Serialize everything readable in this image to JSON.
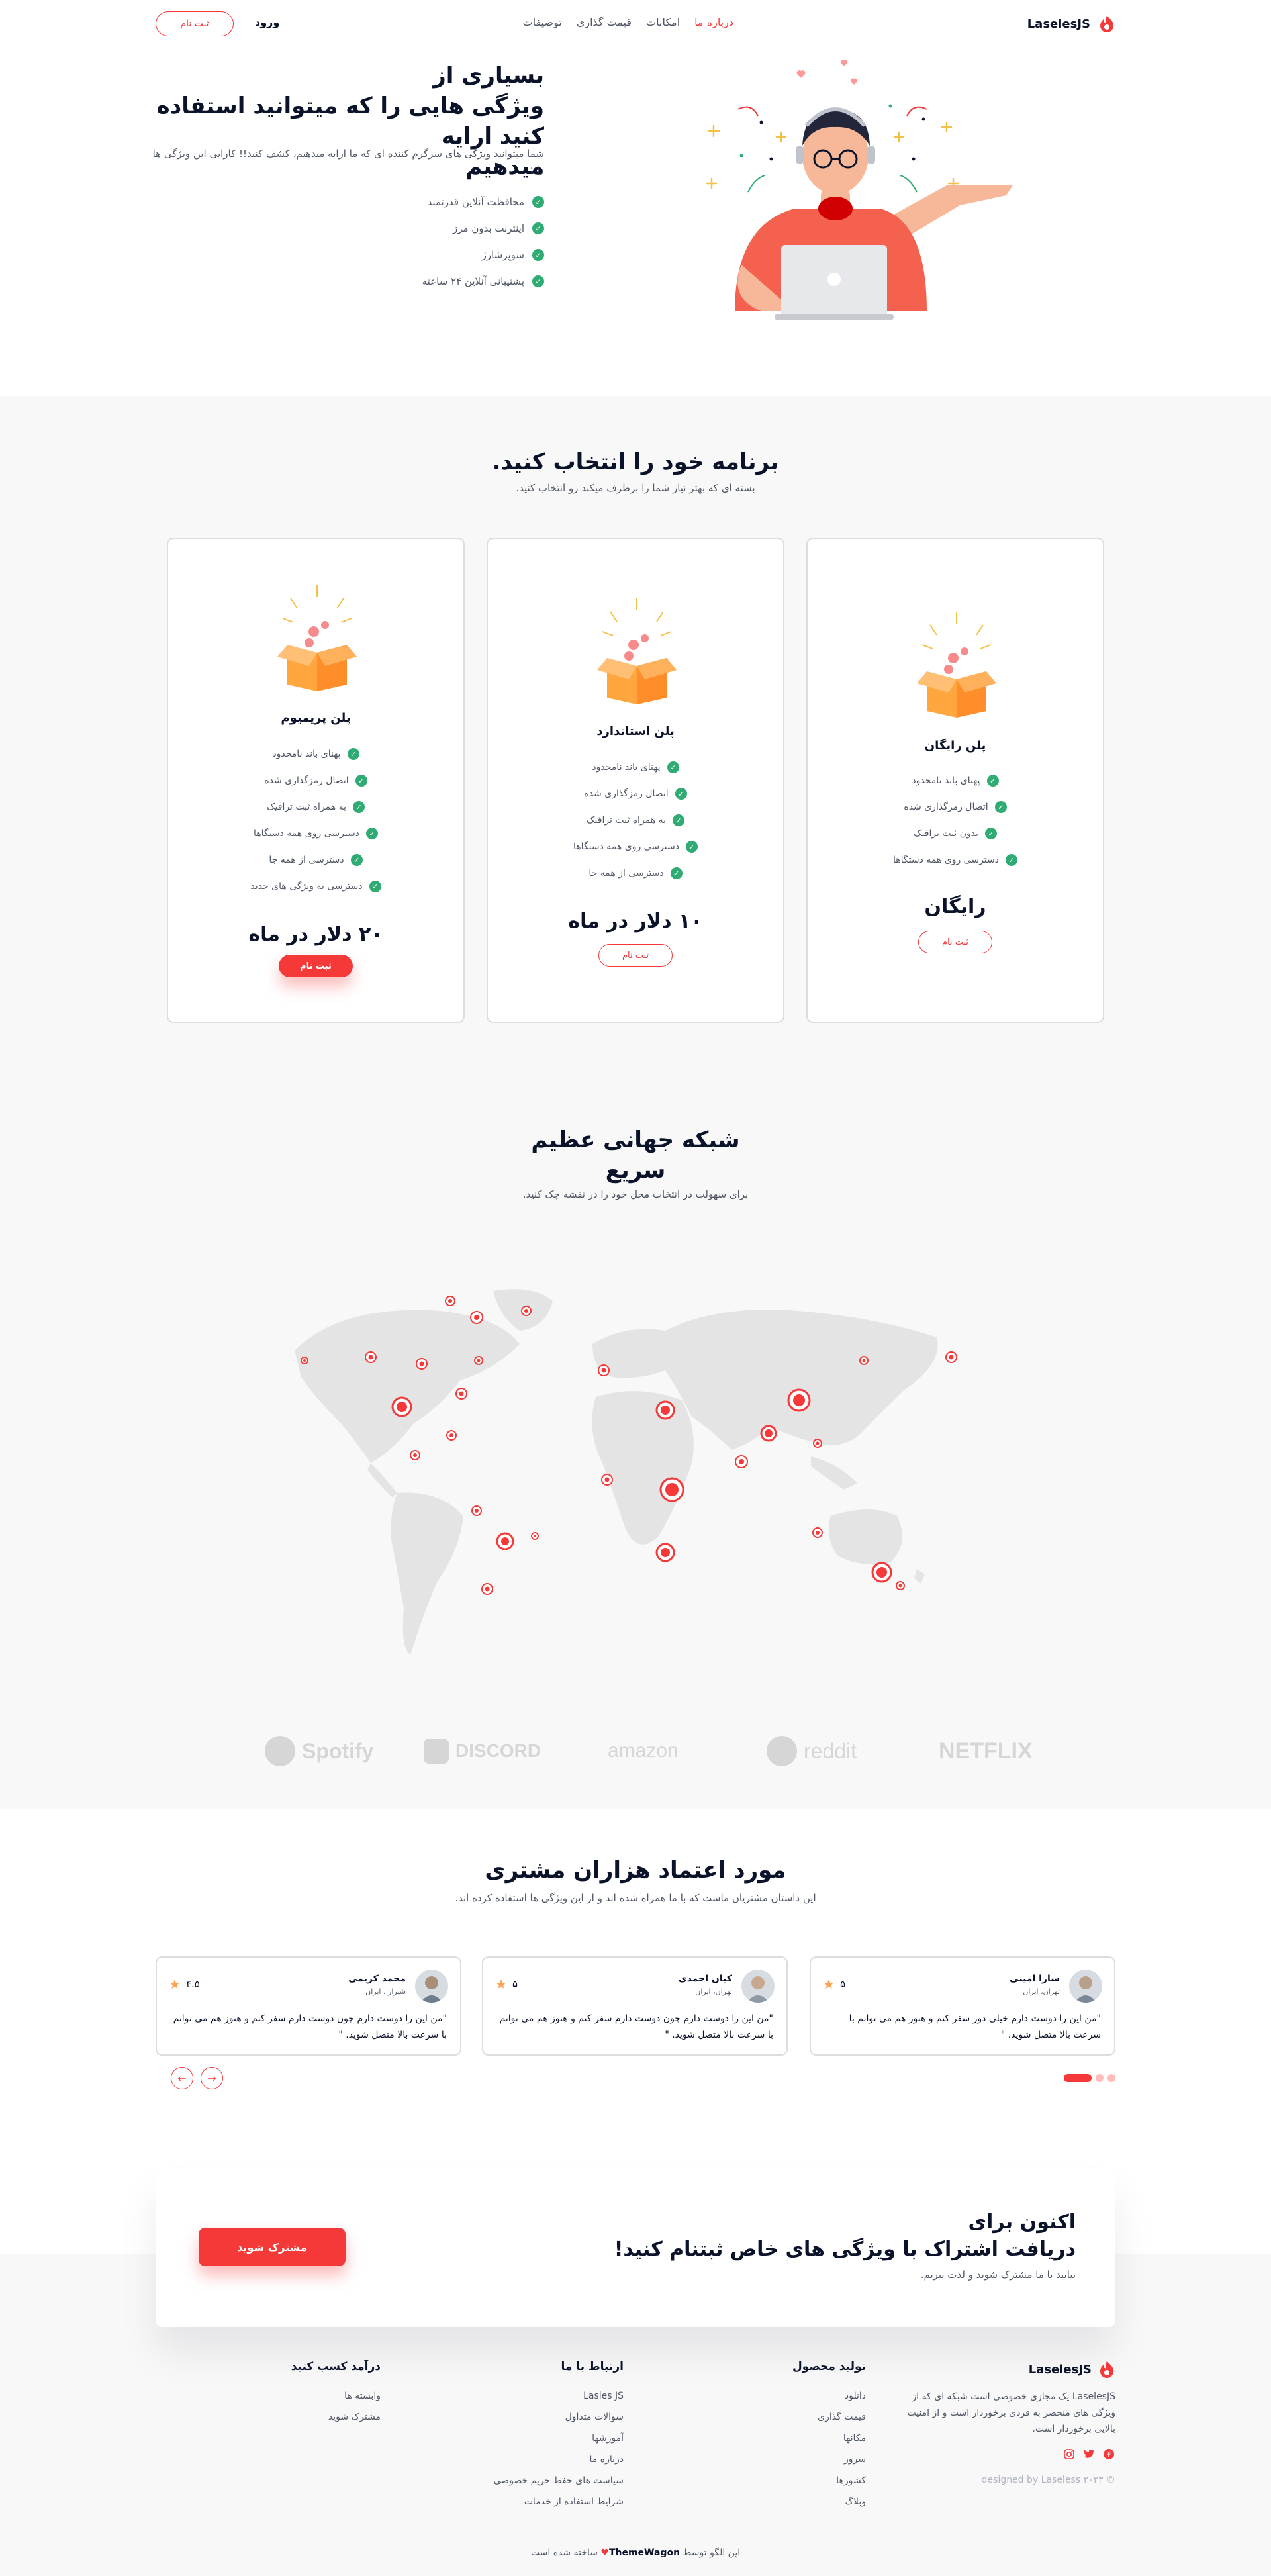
{
  "colors": {
    "accent": "#f53838",
    "check": "#2fab73",
    "star": "#fea250",
    "section_bg": "#f8f8f8"
  },
  "nav": {
    "brand": "LaselesJS",
    "links": [
      {
        "label": "درباره ما",
        "active": true
      },
      {
        "label": "امکانات",
        "active": false
      },
      {
        "label": "قیمت گذاری",
        "active": false
      },
      {
        "label": "توصیفات",
        "active": false
      }
    ],
    "login": "ورود",
    "signup": "ثبت نام"
  },
  "hero": {
    "title_line1": "بسیاری از",
    "title_line2": "ویژگی هایی را که میتوانید استفاده کنید ارایه",
    "title_line3": "میدهیم",
    "description": "شما میتوانید ویژگی های سرگرم کننده ای که ما ارایه میدهیم، کشف کنید!! کارایی این ویژگی ها را :",
    "features": [
      "محافظت آنلاین قدرتمند",
      "اینترنت بدون مرز",
      "سوپرشارژ",
      "پشتیبانی آنلاین ۲۴ ساعته"
    ]
  },
  "plans": {
    "title": "برنامه خود را انتخاب کنید.",
    "subtitle": "بسته ای که بهتر نیاز شما را برطرف میکند رو انتخاب کنید.",
    "items": [
      {
        "name": "پلن رایگان",
        "price": "رایگان",
        "button": "ثبت نام",
        "features": [
          "پهنای باند نامحدود",
          "اتصال رمزگذاری شده",
          "بدون ثبت ترافیک",
          "دسترسی روی همه دستگاها"
        ]
      },
      {
        "name": "پلن استاندارد",
        "price": "۱۰ دلار در ماه",
        "button": "ثبت نام",
        "features": [
          "پهنای باند نامحدود",
          "اتصال رمزگذاری شده",
          "به همراه ثبت ترافیک",
          "دسترسی روی همه دستگاها",
          "دسترسی از همه جا"
        ]
      },
      {
        "name": "پلن پریمیوم",
        "price": "۲۰ دلار در ماه",
        "button": "ثبت نام",
        "features": [
          "پهنای باند نامحدود",
          "اتصال رمزگذاری شده",
          "به همراه ثبت ترافیک",
          "دسترسی روی همه دستگاها",
          "دسترسی از همه جا",
          "دسترسی به ویژگی های جدید"
        ]
      }
    ]
  },
  "network": {
    "title_line1": "شبکه جهانی عظیم",
    "title_line2": "سریع",
    "subtitle": "برای سهولت در انتخاب محل خود را در نقشه چک کنید."
  },
  "partners": [
    "Spotify",
    "DISCORD",
    "amazon",
    "reddit",
    "NETFLIX"
  ],
  "testimonials": {
    "title": "مورد اعتماد هزاران مشتری",
    "subtitle": "این داستان مشتریان ماست که با ما همراه شده اند و از این ویژگی ها استفاده کرده اند.",
    "items": [
      {
        "name": "سارا امینی",
        "location": "تهران، ایران",
        "rating": "۵",
        "text": "\"من این را دوست دارم خیلی دور سفر کنم و هنوز هم می توانم با سرعت بالا متصل شوید. \""
      },
      {
        "name": "کیان احمدی",
        "location": "تهران، ایران",
        "rating": "۵",
        "text": "\"من این را دوست دارم چون دوست دارم سفر کنم و هنوز هم می توانم با سرعت بالا متصل شوید. \""
      },
      {
        "name": "محمد کریمی",
        "location": "شیراز ، ایران",
        "rating": "۴.۵",
        "text": "\"من این را دوست دارم چون دوست دارم سفر کنم و هنوز هم می توانم با سرعت بالا متصل شوید. \""
      }
    ]
  },
  "cta": {
    "title_line1": "اکنون برای",
    "title_line2": "دریافت اشتراک با ویژگی های خاص ثبتنام کنید!",
    "description": "بیایید با ما مشترک شوید و لذت ببریم.",
    "button": "مشترک شوید"
  },
  "footer": {
    "brand": "LaselesJS",
    "description": "LaselesJS یک مجازی خصوصی است شبکه ای که از ویژگی های منحصر به فردی برخوردار است و از امنیت بالایی برخوردار است.",
    "copyright": "designed by Laseless ۲۰۲۳ ©",
    "social": [
      "facebook-icon",
      "twitter-icon",
      "instagram-icon"
    ],
    "columns": [
      {
        "title": "تولید محصول",
        "links": [
          "دانلود",
          "قیمت گذاری",
          "مکانها",
          "سرور",
          "کشورها",
          "وبلاگ"
        ]
      },
      {
        "title": "ارتباط با ما",
        "links": [
          "Lasles JS",
          "سوالات متداول",
          "آموزشها",
          "درباره ما",
          "سیاست های حفظ حریم خصوصی",
          "شرایط استفاده از خدمات"
        ]
      },
      {
        "title": "درآمد کسب کنید",
        "links": [
          "وابسته ها",
          "مشترک شوید"
        ]
      }
    ],
    "credit_prefix": "این الگو توسط",
    "credit_name": "ThemeWagon",
    "credit_suffix": "ساخته شده است"
  }
}
